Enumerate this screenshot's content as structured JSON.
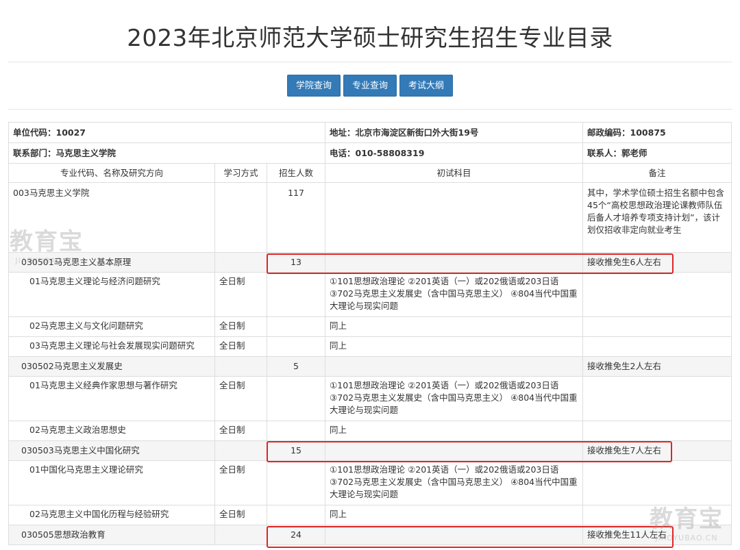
{
  "page": {
    "title": "2023年北京师范大学硕士研究生招生专业目录",
    "buttons": [
      "学院查询",
      "专业查询",
      "考试大纲"
    ]
  },
  "info": {
    "unit_code": "单位代码：10027",
    "address": "地址：北京市海淀区新街口外大街19号",
    "postcode": "邮政编码：100875",
    "department": "联系部门：马克思主义学院",
    "phone": "电话：010-58808319",
    "contact": "联系人：郭老师"
  },
  "headers": {
    "major": "专业代码、名称及研究方向",
    "mode": "学习方式",
    "count": "招生人数",
    "subjects": "初试科目",
    "remark": "备注"
  },
  "rows": {
    "school": {
      "name": "003马克思主义学院",
      "count": "117",
      "remark": "其中，学术学位硕士招生名额中包含45个“高校思想政治理论课教师队伍后备人才培养专项支持计划”，该计划仅招收非定向就业考生"
    },
    "m1": {
      "name": "030501马克思主义基本原理",
      "count": "13",
      "remark": "接收推免生6人左右"
    },
    "m1d1": {
      "name": "01马克思主义理论与经济问题研究",
      "mode": "全日制",
      "subjects": "①101思想政治理论 ②201英语（一）或202俄语或203日语 ③702马克思主义发展史（含中国马克思主义） ④804当代中国重大理论与现实问题"
    },
    "m1d2": {
      "name": "02马克思主义与文化问题研究",
      "mode": "全日制",
      "subjects": "同上"
    },
    "m1d3": {
      "name": "03马克思主义理论与社会发展现实问题研究",
      "mode": "全日制",
      "subjects": "同上"
    },
    "m2": {
      "name": "030502马克思主义发展史",
      "count": "5",
      "remark": "接收推免生2人左右"
    },
    "m2d1": {
      "name": "01马克思主义经典作家思想与著作研究",
      "mode": "全日制",
      "subjects": "①101思想政治理论 ②201英语（一）或202俄语或203日语 ③702马克思主义发展史（含中国马克思主义） ④804当代中国重大理论与现实问题"
    },
    "m2d2": {
      "name": "02马克思主义政治思想史",
      "mode": "全日制",
      "subjects": "同上"
    },
    "m3": {
      "name": "030503马克思主义中国化研究",
      "count": "15",
      "remark": "接收推免生7人左右"
    },
    "m3d1": {
      "name": "01中国化马克思主义理论研究",
      "mode": "全日制",
      "subjects": "①101思想政治理论 ②201英语（一）或202俄语或203日语 ③702马克思主义发展史（含中国马克思主义） ④804当代中国重大理论与现实问题"
    },
    "m3d2": {
      "name": "02马克思主义中国化历程与经验研究",
      "mode": "全日制",
      "subjects": "同上"
    },
    "m4": {
      "name": "030505思想政治教育",
      "count": "24",
      "remark": "接收推免生11人左右"
    }
  },
  "watermark": {
    "brand": "教育宝",
    "site": "JIAOYUBAO.CN"
  }
}
